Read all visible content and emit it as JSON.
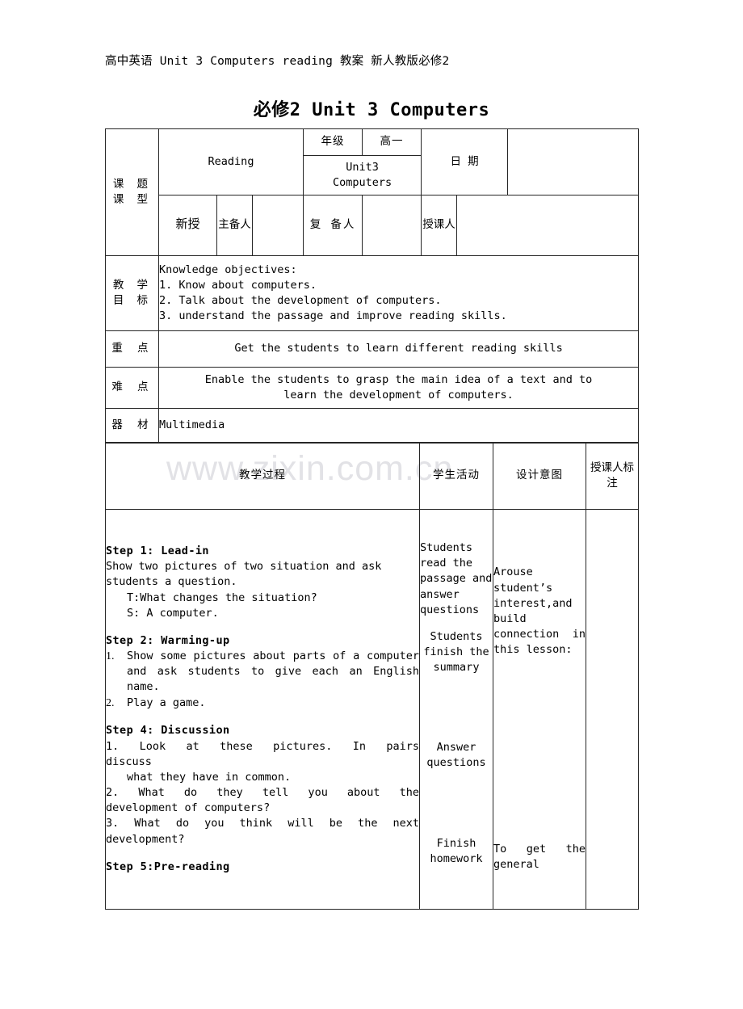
{
  "document": {
    "header_line": "高中英语 Unit 3 Computers reading 教案 新人教版必修2",
    "title": "必修2 Unit 3 Computers",
    "watermark": "www.zixin.com.cn"
  },
  "info_table": {
    "labels": {
      "topic_type": "课 题\n课 型",
      "topic": "课 题",
      "course_type": "课 型",
      "grade": "年级",
      "date": "日 期",
      "main_preparer": "主备人",
      "re_preparer": "复 备人",
      "teacher": "授课人",
      "objectives": "教 学\n目 标",
      "key_points": "重 点",
      "difficult_points": "难 点",
      "equipment": "器 材"
    },
    "values": {
      "topic": "Reading",
      "grade": "高一",
      "unit": "Unit3\nComputers",
      "unit_line1": "Unit3",
      "unit_line2": "Computers",
      "date": "",
      "course_type": "新授",
      "main_preparer": "",
      "re_preparer": "",
      "teacher": ""
    },
    "objectives": {
      "heading": "Knowledge objectives:",
      "items": [
        "1. Know about computers.",
        "2. Talk about the development of computers.",
        "3. understand the passage and improve reading skills."
      ]
    },
    "key_points": "Get the students to learn different reading skills",
    "difficult_points_line1": "Enable the students to grasp the main idea of a text and to",
    "difficult_points_line2": "learn the development of computers.",
    "equipment": "Multimedia"
  },
  "body_table": {
    "headers": {
      "procedure": "教学过程",
      "student_activity": "学生活动",
      "design_intent": "设计意图",
      "teacher_note": "授课人标注"
    },
    "procedure": {
      "step1_title": "Step 1: Lead-in",
      "step1_line1": "Show two pictures of two situation and ask",
      "step1_line2": "students a question.",
      "step1_line3": "T:What changes the situation?",
      "step1_line4": "S: A computer.",
      "step2_title": "Step 2: Warming-up",
      "step2_item1_num": "1.",
      "step2_item1": "Show some pictures about parts of a computer and ask students to give each an English name.",
      "step2_item2_num": "2.",
      "step2_item2": "Play a game.",
      "step4_title": "Step 4: Discussion",
      "step4_item1_line1": "1. Look at these pictures. In pairs",
      "step4_item1_line2": "discuss",
      "step4_item1_line3": "what they have in common.",
      "step4_item2_line1": "2. What do they tell you about the",
      "step4_item2_line2": "development of computers?",
      "step4_item3_line1": "3. What do you think will be the next",
      "step4_item3_line2": "development?",
      "step5_title": "Step 5:Pre-reading"
    },
    "student_activity": {
      "block1": "Students read the passage and answer questions",
      "block2": "Students finish the summary",
      "block3": "Answer questions",
      "block4": "Finish homework"
    },
    "design_intent": {
      "block1": "Arouse student’s interest,and build connection in this lesson:",
      "block2": "To get the general"
    },
    "teacher_note": ""
  }
}
